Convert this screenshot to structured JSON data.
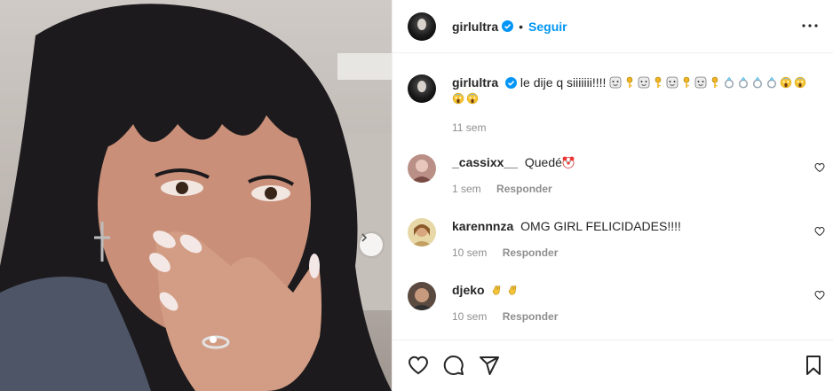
{
  "post": {
    "author": "girlultra",
    "follow_label": "Seguir",
    "separator": "•",
    "caption_text": "le dije q siiiiiii!!!!",
    "caption_emojis": [
      "face-with-tears-emoji",
      "key-emoji",
      "face-with-tears-emoji",
      "key-emoji",
      "face-with-tears-emoji",
      "key-emoji",
      "face-with-tears-emoji",
      "key-emoji",
      "ring-emoji",
      "ring-emoji",
      "ring-emoji",
      "ring-emoji",
      "screaming-face-emoji",
      "screaming-face-emoji",
      "screaming-face-emoji",
      "screaming-face-emoji"
    ],
    "caption_time": "11 sem"
  },
  "comments": [
    {
      "user": "_cassixx__",
      "text": "Quedé",
      "emoji": "clown-emoji",
      "time": "1 sem",
      "reply": "Responder"
    },
    {
      "user": "karennnza",
      "text": "OMG GIRL FELICIDADES!!!!",
      "time": "10 sem",
      "reply": "Responder"
    },
    {
      "user": "djeko",
      "text": "",
      "emoji": "clapping-hands-emoji",
      "time": "10 sem",
      "reply": "Responder"
    }
  ],
  "colors": {
    "accent": "#0095f6",
    "verified": "#0095f6",
    "secondary_text": "#8e8e8e"
  }
}
